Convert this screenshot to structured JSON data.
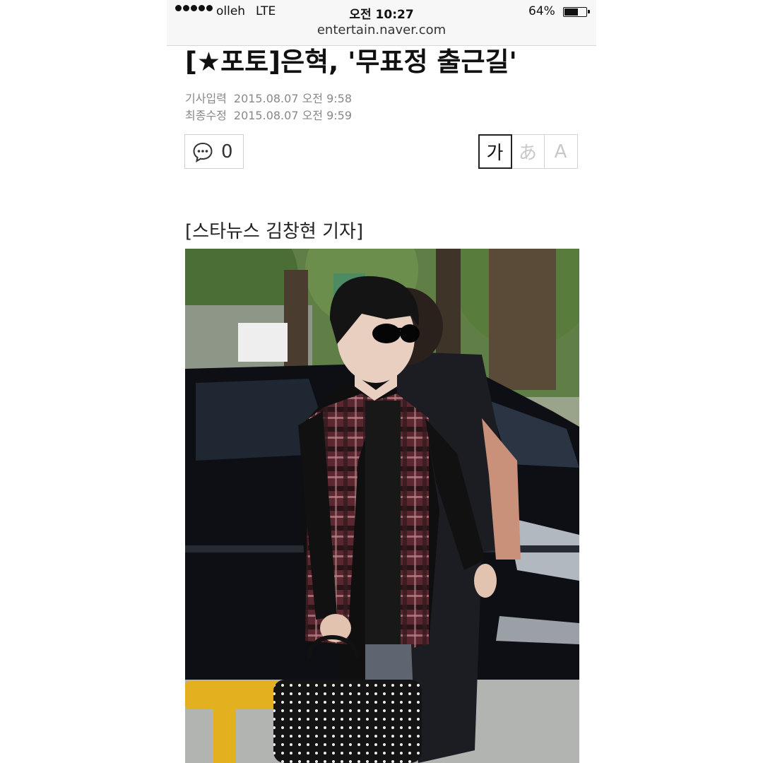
{
  "status_bar": {
    "carrier": "olleh",
    "network": "LTE",
    "time": "오전 10:27",
    "battery_percent": "64%",
    "battery_level": 0.64
  },
  "browser": {
    "url": "entertain.naver.com"
  },
  "article": {
    "headline": "[★포토]은혁, '무표정 출근길'",
    "published_label": "기사입력",
    "published_value": "2015.08.07 오전 9:58",
    "modified_label": "최종수정",
    "modified_value": "2015.08.07 오전 9:59",
    "comment_count": "0",
    "font_options": [
      "가",
      "あ",
      "A"
    ],
    "font_selected_index": 0,
    "byline": "[스타뉴스 김창현 기자]"
  },
  "icons": {
    "comment": "comment-bubble-icon",
    "signal": "signal-dots-icon",
    "battery": "battery-icon"
  }
}
